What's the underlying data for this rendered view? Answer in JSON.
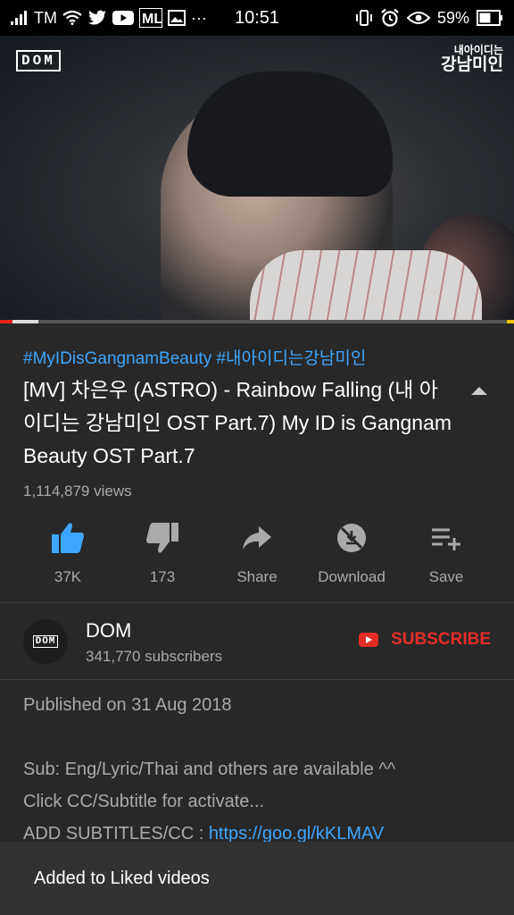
{
  "status_bar": {
    "carrier": "TM",
    "time": "10:51",
    "more": "···",
    "battery": "59%",
    "icons": [
      "signal-icon",
      "wifi-icon",
      "twitter-icon",
      "youtube-icon",
      "ml-icon",
      "image-icon",
      "vibrate-icon",
      "alarm-icon",
      "eye-icon",
      "battery-icon"
    ]
  },
  "video": {
    "channel_logo": "DOM",
    "overlay_title_line1": "내아이디는",
    "overlay_title_line2": "강남미인",
    "progress_fraction": 0.025,
    "buffered_fraction": 0.075
  },
  "info": {
    "hashtags": "#MyIDisGangnamBeauty #내아이디는강남미인",
    "title": "[MV] 차은우 (ASTRO) - Rainbow Falling (내 아이디는 강남미인 OST Part.7) My ID is Gangnam Beauty OST Part.7",
    "views": "1,114,879 views"
  },
  "actions": [
    {
      "label": "37K",
      "icon": "thumbs-up-icon",
      "active": true
    },
    {
      "label": "173",
      "icon": "thumbs-down-icon",
      "active": false
    },
    {
      "label": "Share",
      "icon": "share-icon",
      "active": false
    },
    {
      "label": "Download",
      "icon": "download-icon",
      "active": false
    },
    {
      "label": "Save",
      "icon": "save-playlist-icon",
      "active": false
    }
  ],
  "channel": {
    "avatar_text": "DOM",
    "name": "DOM",
    "subscribers": "341,770 subscribers",
    "subscribe_label": "SUBSCRIBE"
  },
  "description": {
    "published": "Published on 31 Aug 2018",
    "line1": "Sub: Eng/Lyric/Thai and others are available ^^",
    "line2": "Click CC/Subtitle for activate...",
    "line3_prefix": "ADD SUBTITLES/CC : ",
    "line3_link": "https://goo.gl/kKLMAV"
  },
  "toast": {
    "message": "Added to Liked videos"
  },
  "colors": {
    "background": "#282828",
    "link": "#3ea6ff",
    "subscribe_red": "#e52d27",
    "secondary_text": "#aaaaaa",
    "like_active": "#3ea6ff"
  }
}
